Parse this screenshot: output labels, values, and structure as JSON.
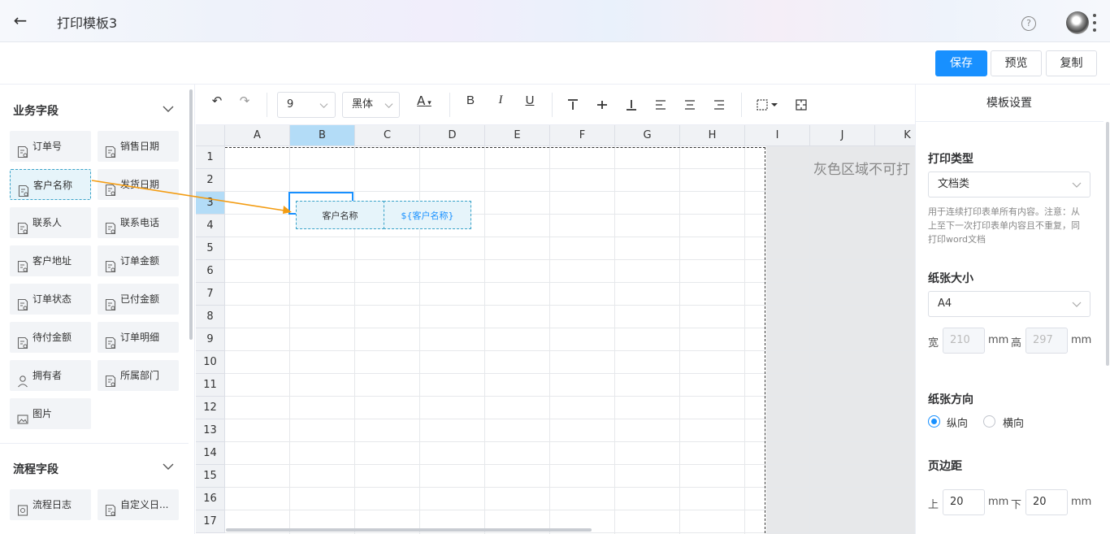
{
  "header": {
    "title": "打印模板3",
    "back_icon": "arrow-left-icon",
    "help_icon": "question-icon"
  },
  "actions": {
    "save": "保存",
    "preview": "预览",
    "copy": "复制"
  },
  "left": {
    "business_title": "业务字段",
    "business_fields": [
      {
        "label": "订单号",
        "icon": "field-icon"
      },
      {
        "label": "销售日期",
        "icon": "field-icon"
      },
      {
        "label": "客户名称",
        "icon": "field-icon"
      },
      {
        "label": "发货日期",
        "icon": "field-icon"
      },
      {
        "label": "联系人",
        "icon": "field-icon"
      },
      {
        "label": "联系电话",
        "icon": "field-icon"
      },
      {
        "label": "客户地址",
        "icon": "field-icon"
      },
      {
        "label": "订单金额",
        "icon": "field-icon"
      },
      {
        "label": "订单状态",
        "icon": "field-icon"
      },
      {
        "label": "已付金额",
        "icon": "field-icon"
      },
      {
        "label": "待付金额",
        "icon": "field-icon"
      },
      {
        "label": "订单明细",
        "icon": "field-icon"
      },
      {
        "label": "拥有者",
        "icon": "user-icon"
      },
      {
        "label": "所属部门",
        "icon": "field-icon"
      },
      {
        "label": "图片",
        "icon": "image-icon"
      }
    ],
    "process_title": "流程字段",
    "process_fields": [
      {
        "label": "流程日志",
        "icon": "log-icon"
      },
      {
        "label": "自定义日...",
        "icon": "field-icon"
      }
    ]
  },
  "toolbar": {
    "font_size": "9",
    "font_family": "黑体",
    "font_color_label": "A",
    "bold": "B",
    "italic": "I",
    "underline": "U"
  },
  "sheet": {
    "columns": [
      "A",
      "B",
      "C",
      "D",
      "E",
      "F",
      "G",
      "H",
      "I",
      "J",
      "K"
    ],
    "rows": [
      "1",
      "2",
      "3",
      "4",
      "5",
      "6",
      "7",
      "8",
      "9",
      "10",
      "11",
      "12",
      "13",
      "14",
      "15",
      "16",
      "17"
    ],
    "active_column": "B",
    "active_row": "3",
    "gray_notice": "灰色区域不可打",
    "drop_label": "客户名称",
    "drop_value": "${客户名称}"
  },
  "right": {
    "title": "模板设置",
    "print_type_label": "打印类型",
    "print_type_value": "文档类",
    "print_type_hint": "用于连续打印表单所有内容。注意：从上至下一次打印表单内容且不重复，同打印word文档",
    "paper_size_label": "纸张大小",
    "paper_size_value": "A4",
    "width_label": "宽",
    "width_value": "210",
    "height_label": "高",
    "height_value": "297",
    "unit": "mm",
    "orientation_label": "纸张方向",
    "portrait": "纵向",
    "landscape": "横向",
    "orientation_selected": "纵向",
    "margin_label": "页边距",
    "top_label": "上",
    "top_value": "20",
    "bottom_label": "下",
    "bottom_value": "20"
  },
  "colors": {
    "primary": "#1890ff",
    "drag_arrow": "#f39c12",
    "drop_border": "#3aa3c9"
  }
}
